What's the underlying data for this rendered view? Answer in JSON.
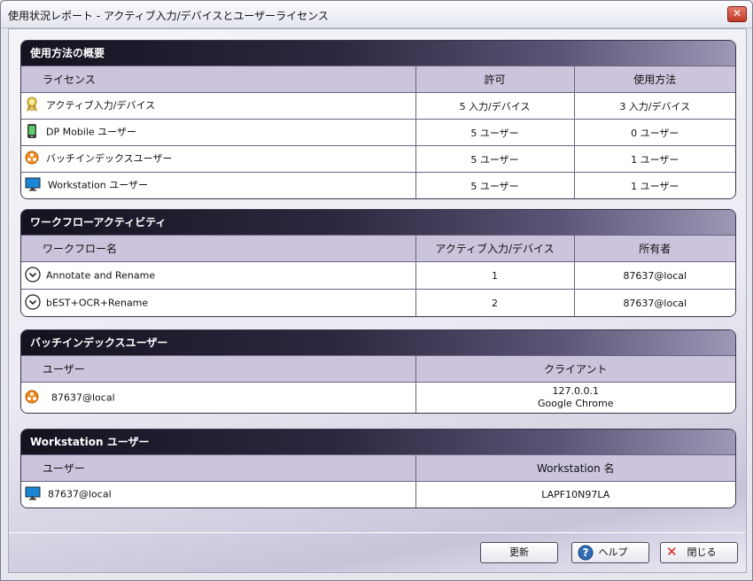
{
  "window": {
    "title": "使用状況レポート - アクティブ入力/デバイスとユーザーライセンス",
    "close_glyph": "✕"
  },
  "usage": {
    "header": "使用方法の概要",
    "columns": [
      "ライセンス",
      "許可",
      "使用方法"
    ],
    "rows": [
      {
        "name": "アクティブ入力/デバイス",
        "allowed": "5 入力/デバイス",
        "used": "3 入力/デバイス",
        "icon": "award-ribbon-icon"
      },
      {
        "name": "DP Mobile ユーザー",
        "allowed": "5 ユーザー",
        "used": "0 ユーザー",
        "icon": "mobile-phone-icon"
      },
      {
        "name": "バッチインデックスユーザー",
        "allowed": "5 ユーザー",
        "used": "1 ユーザー",
        "icon": "batch-index-icon"
      },
      {
        "name": "Workstation ユーザー",
        "allowed": "5 ユーザー",
        "used": "1 ユーザー",
        "icon": "monitor-icon"
      }
    ]
  },
  "workflow": {
    "header": "ワークフローアクティビティ",
    "columns": [
      "ワークフロー名",
      "アクティブ入力/デバイス",
      "所有者"
    ],
    "rows": [
      {
        "name": "Annotate and Rename",
        "active": "1",
        "owner": "87637@local"
      },
      {
        "name": "bEST+OCR+Rename",
        "active": "2",
        "owner": "87637@local"
      }
    ]
  },
  "batch": {
    "header": "バッチインデックスユーザー",
    "columns": [
      "ユーザー",
      "クライアント"
    ],
    "rows": [
      {
        "user": "87637@local",
        "client_ip": "127.0.0.1",
        "client_browser": "Google Chrome"
      }
    ]
  },
  "workstation": {
    "header": "Workstation ユーザー",
    "columns": [
      "ユーザー",
      "Workstation 名"
    ],
    "rows": [
      {
        "user": "87637@local",
        "workstation": "LAPF10N97LA"
      }
    ]
  },
  "buttons": {
    "refresh": "更新",
    "help": "ヘルプ",
    "close": "閉じる",
    "help_glyph": "?",
    "close_glyph": "✕"
  },
  "colors": {
    "header_dark": "#15121f",
    "column_header": "#cbc4dc",
    "accent_orange": "#f08a1c",
    "monitor_blue": "#1a86d6"
  }
}
